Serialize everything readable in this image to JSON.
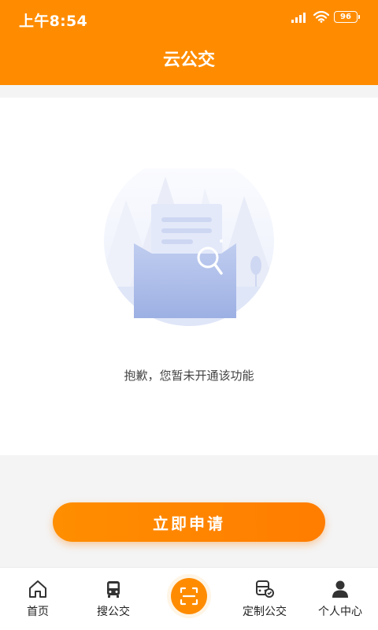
{
  "status_bar": {
    "time": "上午8:54",
    "battery": "96"
  },
  "header": {
    "title": "云公交"
  },
  "empty_state": {
    "message": "抱歉，您暂未开通该功能"
  },
  "apply_button": {
    "label": "立即申请"
  },
  "tabbar": {
    "items": [
      {
        "label": "首页",
        "icon": "home-icon"
      },
      {
        "label": "搜公交",
        "icon": "bus-icon"
      },
      {
        "label": "",
        "icon": "scan-icon"
      },
      {
        "label": "定制公交",
        "icon": "custom-bus-icon"
      },
      {
        "label": "个人中心",
        "icon": "person-icon"
      }
    ]
  },
  "colors": {
    "accent": "#ff8c00",
    "background": "#f4f4f4",
    "illustration": "#a9b9e6"
  }
}
